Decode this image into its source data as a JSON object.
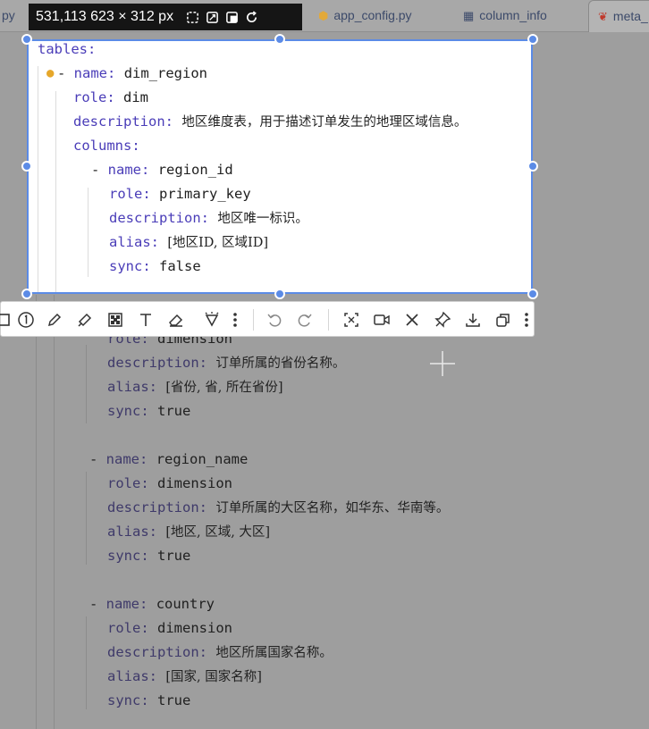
{
  "tabs": [
    {
      "label": "py",
      "icon": "none"
    },
    {
      "label": "app_config.py",
      "icon": "python-file-icon"
    },
    {
      "label": "column_info",
      "icon": "table-icon"
    },
    {
      "label": "meta_",
      "icon": "yaml-file-icon",
      "active": true
    }
  ],
  "size_tooltip": {
    "text": "531,113  623 × 312  px",
    "icons": [
      "fit-icon",
      "expand-icon",
      "window-icon",
      "refresh-icon"
    ]
  },
  "code": {
    "root_key": "tables:",
    "table": {
      "name_key": "name:",
      "name_val": "dim_region",
      "role_key": "role:",
      "role_val": "dim",
      "desc_key": "description:",
      "desc_val": "地区维度表，用于描述订单发生的地理区域信息。",
      "columns_key": "columns:"
    },
    "columns": [
      {
        "name_key": "name:",
        "name_val": "region_id",
        "role_key": "role:",
        "role_val": "primary_key",
        "desc_key": "description:",
        "desc_val": "地区唯一标识。",
        "alias_key": "alias:",
        "alias_val": "[地区ID, 区域ID]",
        "sync_key": "sync:",
        "sync_val": "false"
      },
      {
        "role_key": "role:",
        "role_val": "dimension",
        "desc_key": "description:",
        "desc_val": "订单所属的省份名称。",
        "alias_key": "alias:",
        "alias_val": "[省份, 省, 所在省份]",
        "sync_key": "sync:",
        "sync_val": "true"
      },
      {
        "name_key": "name:",
        "name_val": "region_name",
        "role_key": "role:",
        "role_val": "dimension",
        "desc_key": "description:",
        "desc_val": "订单所属的大区名称，如华东、华南等。",
        "alias_key": "alias:",
        "alias_val": "[地区, 区域, 大区]",
        "sync_key": "sync:",
        "sync_val": "true"
      },
      {
        "name_key": "name:",
        "name_val": "country",
        "role_key": "role:",
        "role_val": "dimension",
        "desc_key": "description:",
        "desc_val": "地区所属国家名称。",
        "alias_key": "alias:",
        "alias_val": "[国家, 国家名称]",
        "sync_key": "sync:",
        "sync_val": "true"
      }
    ]
  },
  "toolbar": {
    "tools": [
      "rectangle-icon",
      "number-icon",
      "pen-icon",
      "highlighter-icon",
      "mosaic-icon",
      "text-icon",
      "eraser-icon",
      "magic-icon",
      "more-icon",
      "undo-icon",
      "redo-icon",
      "ocr-icon",
      "record-icon",
      "close-icon",
      "pin-icon",
      "download-icon",
      "copy-icon",
      "more-icon"
    ]
  },
  "colors": {
    "selection": "#5b8be6",
    "key": "#4a3db8",
    "bulb": "#e6a72a"
  }
}
